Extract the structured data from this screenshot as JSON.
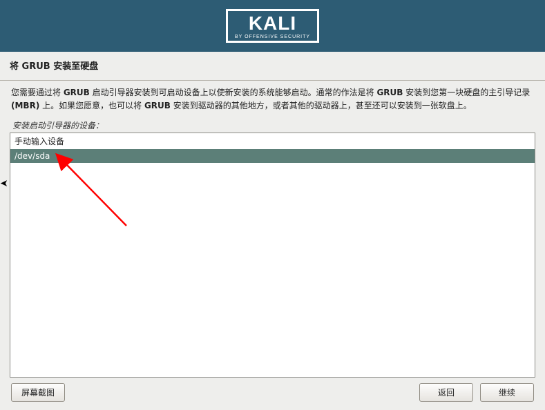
{
  "header": {
    "logo_text": "KALI",
    "logo_sub": "BY OFFENSIVE SECURITY"
  },
  "title": "将 GRUB 安装至硬盘",
  "description_line1_a": "您需要通过将 ",
  "description_line1_b": "GRUB",
  "description_line1_c": " 启动引导器安装到可启动设备上以使新安装的系统能够启动。通常的作法是将 ",
  "description_line1_d": "GRUB",
  "description_line1_e": " 安装到您第一块硬盘的主引导记录 ",
  "description_line2_a": "(MBR)",
  "description_line2_b": " 上。如果您愿意，也可以将 ",
  "description_line2_c": "GRUB",
  "description_line2_d": " 安装到驱动器的其他地方，或者其他的驱动器上，甚至还可以安装到一张软盘上。",
  "field_label": "安装启动引导器的设备：",
  "list": {
    "items": [
      {
        "label": "手动输入设备",
        "selected": false
      },
      {
        "label": "/dev/sda",
        "selected": true
      }
    ]
  },
  "buttons": {
    "screenshot": "屏幕截图",
    "back": "返回",
    "continue": "继续"
  }
}
